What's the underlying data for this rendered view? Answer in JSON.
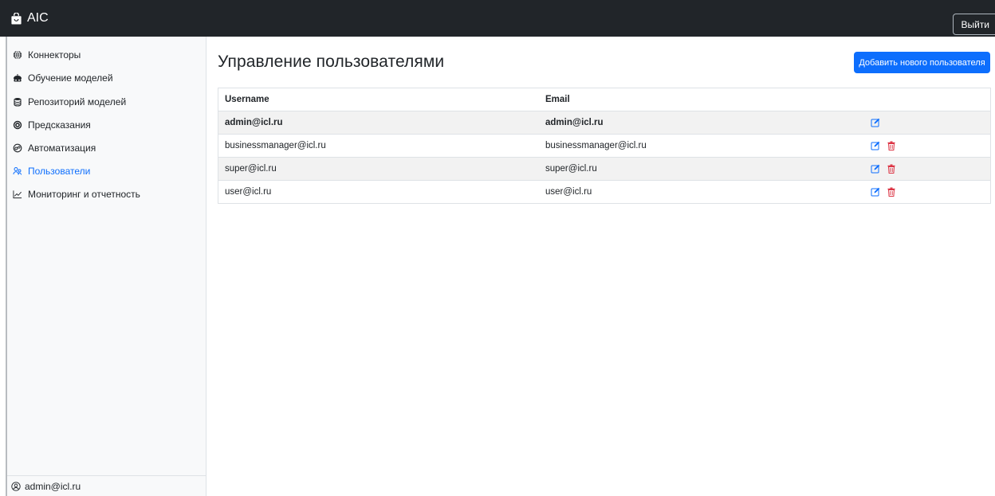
{
  "app": {
    "brand": "AIC",
    "logout_label": "Выйти"
  },
  "sidebar": {
    "items": [
      {
        "label": "Коннекторы",
        "icon": "globe-icon",
        "active": false
      },
      {
        "label": "Обучение моделей",
        "icon": "robot-icon",
        "active": false
      },
      {
        "label": "Репозиторий моделей",
        "icon": "database-icon",
        "active": false
      },
      {
        "label": "Предсказания",
        "icon": "target-icon",
        "active": false
      },
      {
        "label": "Автоматизация",
        "icon": "gears-icon",
        "active": false
      },
      {
        "label": "Пользователи",
        "icon": "users-icon",
        "active": true
      },
      {
        "label": "Мониторинг и отчетность",
        "icon": "chart-line-icon",
        "active": false
      }
    ],
    "footer_user": "admin@icl.ru"
  },
  "main": {
    "title": "Управление пользователями",
    "add_button_label": "Добавить нового пользователя",
    "table": {
      "headers": {
        "username": "Username",
        "email": "Email"
      },
      "rows": [
        {
          "username": "admin@icl.ru",
          "email": "admin@icl.ru",
          "current": true,
          "deletable": false
        },
        {
          "username": "businessmanager@icl.ru",
          "email": "businessmanager@icl.ru",
          "current": false,
          "deletable": true
        },
        {
          "username": "super@icl.ru",
          "email": "super@icl.ru",
          "current": false,
          "deletable": true
        },
        {
          "username": "user@icl.ru",
          "email": "user@icl.ru",
          "current": false,
          "deletable": true
        }
      ]
    }
  },
  "colors": {
    "primary": "#0d6efd",
    "danger": "#dc3545",
    "topbar": "#212529"
  }
}
